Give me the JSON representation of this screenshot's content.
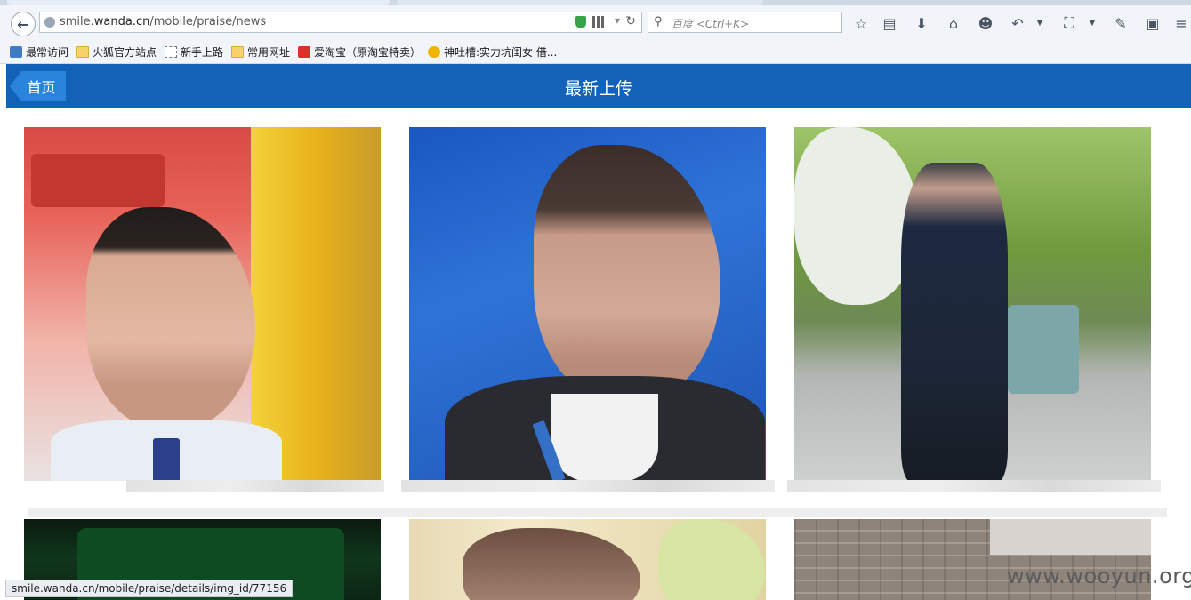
{
  "browser": {
    "url_prefix": "smile.",
    "url_host": "wanda.cn",
    "url_path": "/mobile/praise/news",
    "search_placeholder": "百度 <Ctrl+K>",
    "toolbar_icons": [
      "star-icon",
      "reading-list-icon",
      "download-icon",
      "home-icon",
      "smiley-icon",
      "undo-icon",
      "crop-icon",
      "chat-icon",
      "reader-icon"
    ]
  },
  "bookmarks": [
    {
      "label": "最常访问",
      "icon": "most-visited-icon"
    },
    {
      "label": "火狐官方站点",
      "icon": "folder-icon"
    },
    {
      "label": "新手上路",
      "icon": "dashed-page-icon"
    },
    {
      "label": "常用网址",
      "icon": "folder-icon"
    },
    {
      "label": "爱淘宝（原淘宝特卖）",
      "icon": "taobao-icon"
    },
    {
      "label": "神吐槽:实力坑闺女 借...",
      "icon": "emoji-icon"
    }
  ],
  "header": {
    "home_label": "首页",
    "title": "最新上传"
  },
  "gallery": {
    "photos": [
      {
        "subject": "man in glasses in front of red banner"
      },
      {
        "subject": "woman in dark suit with lanyard"
      },
      {
        "subject": "man standing in park"
      },
      {
        "subject": "dark screen photo"
      },
      {
        "subject": "close-up portrait"
      },
      {
        "subject": "stack of bricks"
      }
    ]
  },
  "status_url": "smile.wanda.cn/mobile/praise/details/img_id/77156",
  "watermark": "www.wooyun.org",
  "colors": {
    "header": "#1262b7",
    "home_button": "#2a84db"
  }
}
